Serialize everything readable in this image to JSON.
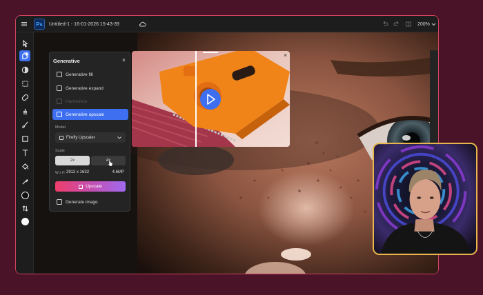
{
  "topbar": {
    "menu_icon": "hamburger-menu-icon",
    "app_logo": "Ps",
    "document_title": "Untitled-1 - 16-01-2026 15-43-39",
    "cloud_icon": "cloud-icon",
    "zoom_level": "200%"
  },
  "generative_panel": {
    "title": "Generative",
    "items": [
      {
        "label": "Generative fill",
        "icon": "generative-fill-icon"
      },
      {
        "label": "Generative expand",
        "icon": "generative-expand-icon"
      },
      {
        "label": "Harmonize",
        "icon": "harmonize-icon"
      },
      {
        "label": "Generative upscale",
        "icon": "generative-upscale-icon"
      }
    ],
    "model_label": "Model",
    "model_value": "Firefly Upscaler",
    "scale_label": "Scale",
    "scale_options": [
      "2x",
      "4x"
    ],
    "selected_scale": "4x",
    "dimensions_label": "W x H",
    "dimensions_value": "2912 x 1632",
    "megapixels": "4.6MP",
    "upscale_button": "Upscale",
    "generate_image": "Generate image"
  },
  "colors": {
    "background": "#4a1328",
    "frame_border": "#d0445e",
    "accent_blue": "#3d6ff0",
    "upscale_gradient_start": "#ef3d6b",
    "upscale_gradient_end": "#a06af0",
    "facecam_border": "#e8b64d",
    "preview_orange": "#f08418"
  }
}
